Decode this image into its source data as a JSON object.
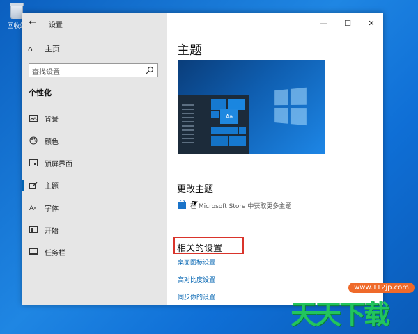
{
  "desktop": {
    "recycle_bin_label": "回收站"
  },
  "window": {
    "title": "设置",
    "controls": {
      "minimize": "—",
      "maximize": "☐",
      "close": "✕"
    }
  },
  "sidebar": {
    "home_label": "主页",
    "search": {
      "placeholder": "查找设置",
      "value": ""
    },
    "section_title": "个性化",
    "items": [
      {
        "label": "背景",
        "icon": "image-icon"
      },
      {
        "label": "颜色",
        "icon": "palette-icon"
      },
      {
        "label": "锁屏界面",
        "icon": "lock-screen-icon"
      },
      {
        "label": "主题",
        "icon": "theme-brush-icon",
        "active": true
      },
      {
        "label": "字体",
        "icon": "font-icon"
      },
      {
        "label": "开始",
        "icon": "start-icon"
      },
      {
        "label": "任务栏",
        "icon": "taskbar-icon"
      }
    ]
  },
  "main": {
    "title": "主题",
    "preview": {
      "sample_text": "Aa"
    },
    "change_theme": {
      "heading": "更改主题",
      "store_link": "在 Microsoft Store 中获取更多主题"
    },
    "related": {
      "heading": "相关的设置",
      "links": [
        "桌面图标设置",
        "高对比度设置",
        "同步你的设置"
      ]
    }
  },
  "watermark": {
    "chars": "天天下载",
    "url": "www.TT2jp.com"
  },
  "colors": {
    "accent": "#0063b1",
    "highlight_box": "#d9342b",
    "sidebar_bg": "#e6e6e6",
    "watermark_green": "#22c55e",
    "watermark_orange": "#ef6a2a"
  }
}
